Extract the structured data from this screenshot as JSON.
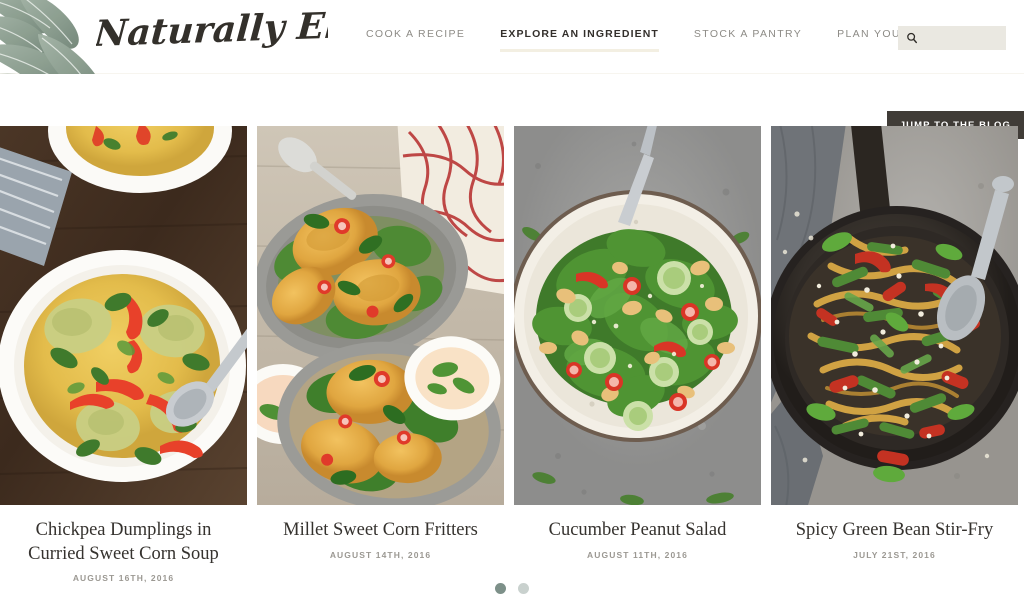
{
  "site": {
    "brand_name": "Naturally Ella",
    "leaf_color": "#8fa193",
    "brand_color": "#34312c",
    "accent_underline": "#f3efe2",
    "cta_bg": "#403c37"
  },
  "nav": {
    "items": [
      {
        "label": "COOK A RECIPE",
        "active": false
      },
      {
        "label": "EXPLORE AN INGREDIENT",
        "active": true
      },
      {
        "label": "STOCK A PANTRY",
        "active": false
      },
      {
        "label": "PLAN YOUR MEALS",
        "active": false
      }
    ]
  },
  "search": {
    "icon": "search-icon",
    "placeholder": "",
    "value": ""
  },
  "cta": {
    "jump_label": "JUMP TO THE BLOG"
  },
  "carousel": {
    "cards": [
      {
        "title": "Chickpea Dumplings in Curried Sweet Corn Soup",
        "date": "AUGUST 16TH, 2016",
        "image_alt": "golden curried sweet corn soup with chickpea dumplings, red chili strips and cilantro in a white bowl on dark wood"
      },
      {
        "title": "Millet Sweet Corn Fritters",
        "date": "AUGUST 14TH, 2016",
        "image_alt": "golden millet sweet corn fritters on greens in metal trays with dipping sauce and a red patterned cloth"
      },
      {
        "title": "Cucumber Peanut Salad",
        "date": "AUGUST 11TH, 2016",
        "image_alt": "green cucumber peanut salad with red chilies on a cream speckled plate over grey concrete"
      },
      {
        "title": "Spicy Green Bean Stir-Fry",
        "date": "JULY 21ST, 2016",
        "image_alt": "noodle stir-fry with green beans, red pepper and sesame seeds in a dark cast iron skillet"
      }
    ],
    "dots": [
      {
        "active": true,
        "color": "#7d9089"
      },
      {
        "active": false,
        "color": "#c9d1ce"
      }
    ]
  }
}
